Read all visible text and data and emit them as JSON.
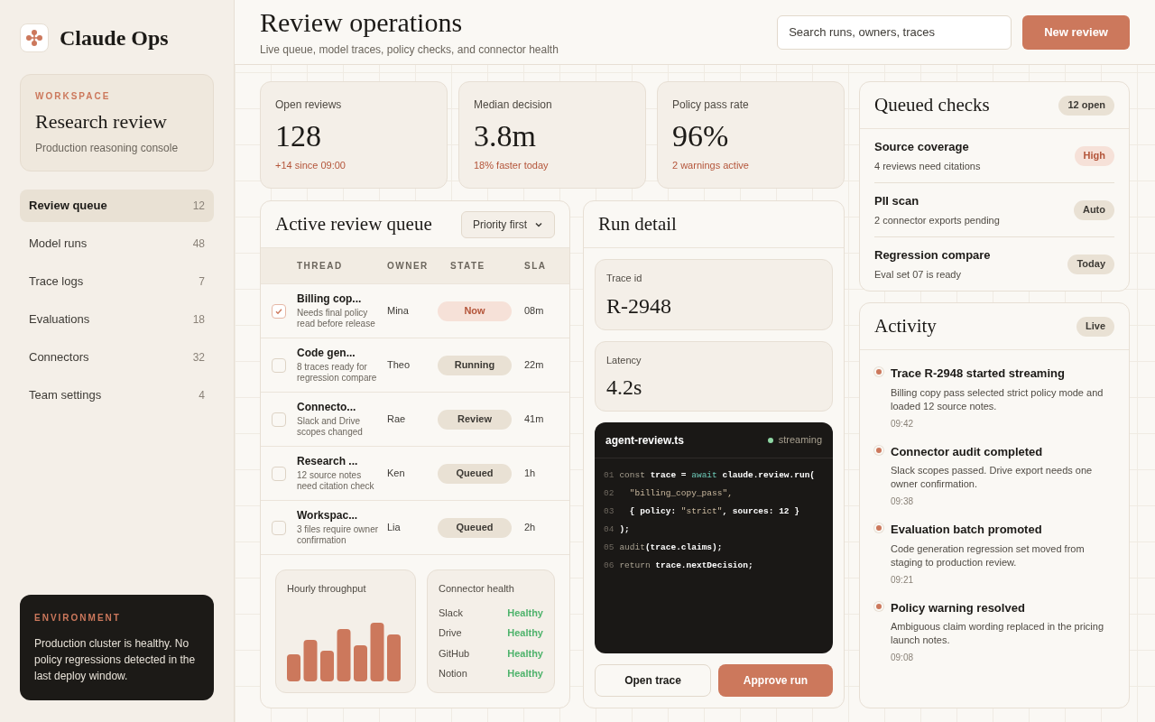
{
  "sidebar": {
    "brand": "Claude Ops",
    "workspace": {
      "eyebrow": "WORKSPACE",
      "name": "Research review",
      "description": "Production reasoning console"
    },
    "nav": [
      {
        "label": "Review queue",
        "count": "12",
        "selected": true
      },
      {
        "label": "Model runs",
        "count": "48",
        "selected": false
      },
      {
        "label": "Trace logs",
        "count": "7",
        "selected": false
      },
      {
        "label": "Evaluations",
        "count": "18",
        "selected": false
      },
      {
        "label": "Connectors",
        "count": "32",
        "selected": false
      },
      {
        "label": "Team settings",
        "count": "4",
        "selected": false
      }
    ],
    "environment": {
      "eyebrow": "ENVIRONMENT",
      "message": "Production cluster is healthy. No policy regressions detected in the last deploy window."
    }
  },
  "header": {
    "title": "Review operations",
    "subtitle": "Live queue, model traces, policy checks, and connector health",
    "search": {
      "placeholder": "Search runs, owners, traces"
    },
    "primary_button": "New review"
  },
  "stats": [
    {
      "label": "Open reviews",
      "value": "128",
      "note": "+14 since 09:00"
    },
    {
      "label": "Median decision",
      "value": "3.8m",
      "note": "18% faster today"
    },
    {
      "label": "Policy pass rate",
      "value": "96%",
      "note": "2 warnings active"
    }
  ],
  "queue": {
    "title": "Active review queue",
    "sort": "Priority first",
    "columns": [
      "THREAD",
      "OWNER",
      "STATE",
      "SLA"
    ],
    "rows": [
      {
        "checked": true,
        "title": "Billing cop...",
        "description": "Needs final policy read before release",
        "owner": "Mina",
        "state": {
          "label": "Now",
          "kind": "urgent"
        },
        "sla": "08m"
      },
      {
        "checked": false,
        "title": "Code gen...",
        "description": "8 traces ready for regression compare",
        "owner": "Theo",
        "state": {
          "label": "Running",
          "kind": "normal"
        },
        "sla": "22m"
      },
      {
        "checked": false,
        "title": "Connecto...",
        "description": "Slack and Drive scopes changed",
        "owner": "Rae",
        "state": {
          "label": "Review",
          "kind": "normal"
        },
        "sla": "41m"
      },
      {
        "checked": false,
        "title": "Research ...",
        "description": "12 source notes need citation check",
        "owner": "Ken",
        "state": {
          "label": "Queued",
          "kind": "normal"
        },
        "sla": "1h"
      },
      {
        "checked": false,
        "title": "Workspac...",
        "description": "3 files require owner confirmation",
        "owner": "Lia",
        "state": {
          "label": "Queued",
          "kind": "normal"
        },
        "sla": "2h"
      }
    ],
    "throughput": {
      "title": "Hourly throughput"
    },
    "connectors": {
      "title": "Connector health",
      "items": [
        {
          "name": "Slack",
          "status": "Healthy"
        },
        {
          "name": "Drive",
          "status": "Healthy"
        },
        {
          "name": "GitHub",
          "status": "Healthy"
        },
        {
          "name": "Notion",
          "status": "Healthy"
        }
      ]
    }
  },
  "run_detail": {
    "title": "Run detail",
    "metrics": [
      {
        "label": "Trace id",
        "value": "R-2948"
      },
      {
        "label": "Latency",
        "value": "4.2s"
      }
    ],
    "code": {
      "filename": "agent-review.ts",
      "status": "streaming",
      "lines": [
        {
          "number": "01",
          "segments": [
            {
              "text": "const ",
              "kind": "keyword"
            },
            {
              "text": "trace = ",
              "kind": "ident"
            },
            {
              "text": "await ",
              "kind": "await"
            },
            {
              "text": "claude.review.run(",
              "kind": "ident"
            }
          ]
        },
        {
          "number": "02",
          "segments": [
            {
              "text": "  \"billing_copy_pass\",",
              "kind": "string"
            }
          ]
        },
        {
          "number": "03",
          "segments": [
            {
              "text": "  { policy: ",
              "kind": "ident"
            },
            {
              "text": "\"strict\"",
              "kind": "string"
            },
            {
              "text": ", sources: 12 }",
              "kind": "ident"
            }
          ]
        },
        {
          "number": "04",
          "segments": [
            {
              "text": ");",
              "kind": "ident"
            }
          ]
        },
        {
          "number": "05",
          "segments": [
            {
              "text": "audit",
              "kind": "keyword"
            },
            {
              "text": "(trace.claims);",
              "kind": "ident"
            }
          ]
        },
        {
          "number": "06",
          "segments": [
            {
              "text": "return ",
              "kind": "keyword"
            },
            {
              "text": "trace.nextDecision;",
              "kind": "ident"
            }
          ]
        }
      ]
    },
    "buttons": [
      {
        "label": "Open trace",
        "kind": "secondary"
      },
      {
        "label": "Approve run",
        "kind": "primary"
      }
    ]
  },
  "queued_checks": {
    "title": "Queued checks",
    "badge": "12 open",
    "items": [
      {
        "title": "Source coverage",
        "description": "4 reviews need citations",
        "badge": {
          "label": "High",
          "kind": "urgent"
        }
      },
      {
        "title": "PII scan",
        "description": "2 connector exports pending",
        "badge": {
          "label": "Auto",
          "kind": "normal"
        }
      },
      {
        "title": "Regression compare",
        "description": "Eval set 07 is ready",
        "badge": {
          "label": "Today",
          "kind": "normal"
        }
      }
    ]
  },
  "activity": {
    "title": "Activity",
    "badge": "Live",
    "events": [
      {
        "title": "Trace R-2948 started streaming",
        "description": "Billing copy pass selected strict policy mode and loaded 12 source notes.",
        "time": "09:42"
      },
      {
        "title": "Connector audit completed",
        "description": "Slack scopes passed. Drive export needs one owner confirmation.",
        "time": "09:38"
      },
      {
        "title": "Evaluation batch promoted",
        "description": "Code generation regression set moved from staging to production review.",
        "time": "09:21"
      },
      {
        "title": "Policy warning resolved",
        "description": "Ambiguous claim wording replaced in the pricing launch notes.",
        "time": "09:08"
      }
    ]
  }
}
